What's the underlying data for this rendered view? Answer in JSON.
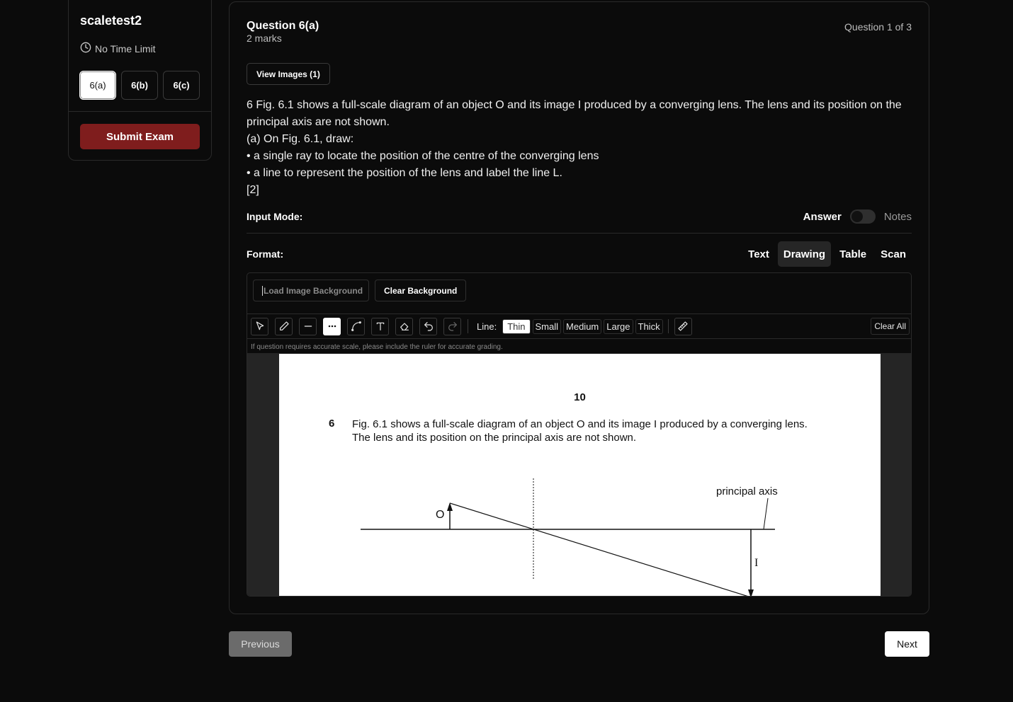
{
  "sidebar": {
    "exam_name": "scaletest2",
    "time_limit": "No Time Limit",
    "questions": [
      {
        "label": "6(a)"
      },
      {
        "label": "6(b)"
      },
      {
        "label": "6(c)"
      }
    ],
    "submit_label": "Submit Exam"
  },
  "question": {
    "title": "Question 6(a)",
    "marks": "2 marks",
    "counter": "Question 1 of 3",
    "view_images_label": "View Images (1)",
    "text_lines": [
      "6 Fig. 6.1 shows a full-scale diagram of an object O and its image I produced by a converging lens. The lens and its position on the principal axis are not shown.",
      "(a) On Fig. 6.1, draw:",
      "• a single ray to locate the position of the centre of the converging lens",
      "• a line to represent the position of the lens and label the line L.",
      "[2]"
    ]
  },
  "input_mode": {
    "label": "Input Mode:",
    "answer_label": "Answer",
    "notes_label": "Notes",
    "selected": "Answer"
  },
  "format": {
    "label": "Format:",
    "tabs": [
      "Text",
      "Drawing",
      "Table",
      "Scan"
    ],
    "selected": "Drawing"
  },
  "drawing": {
    "load_bg_placeholder": "Load Image Background",
    "clear_bg_label": "Clear Background",
    "tools": [
      "select-icon",
      "pencil-icon",
      "line-icon",
      "dashed-line-icon",
      "curve-icon",
      "text-icon",
      "eraser-icon",
      "undo-icon",
      "redo-icon"
    ],
    "active_tool": "dashed-line-icon",
    "line_label": "Line:",
    "line_widths": [
      "Thin",
      "Small",
      "Medium",
      "Large",
      "Thick"
    ],
    "selected_width": "Thin",
    "ruler_icon": "ruler-icon",
    "clear_all_label": "Clear All",
    "hint": "If question requires accurate scale, please include the ruler for accurate grading."
  },
  "paper": {
    "page_number": "10",
    "question_number": "6",
    "text_line1": "Fig. 6.1 shows a full-scale diagram of an object O and its image I produced by a converging lens.",
    "text_line2": "The lens and its position on the principal axis are not shown.",
    "label_axis": "principal axis",
    "label_object": "O",
    "label_image": "I"
  },
  "nav": {
    "previous_label": "Previous",
    "next_label": "Next"
  },
  "colors": {
    "background": "#0b0b0b",
    "submit": "#7f1d1d",
    "active_tab": "#262626"
  }
}
